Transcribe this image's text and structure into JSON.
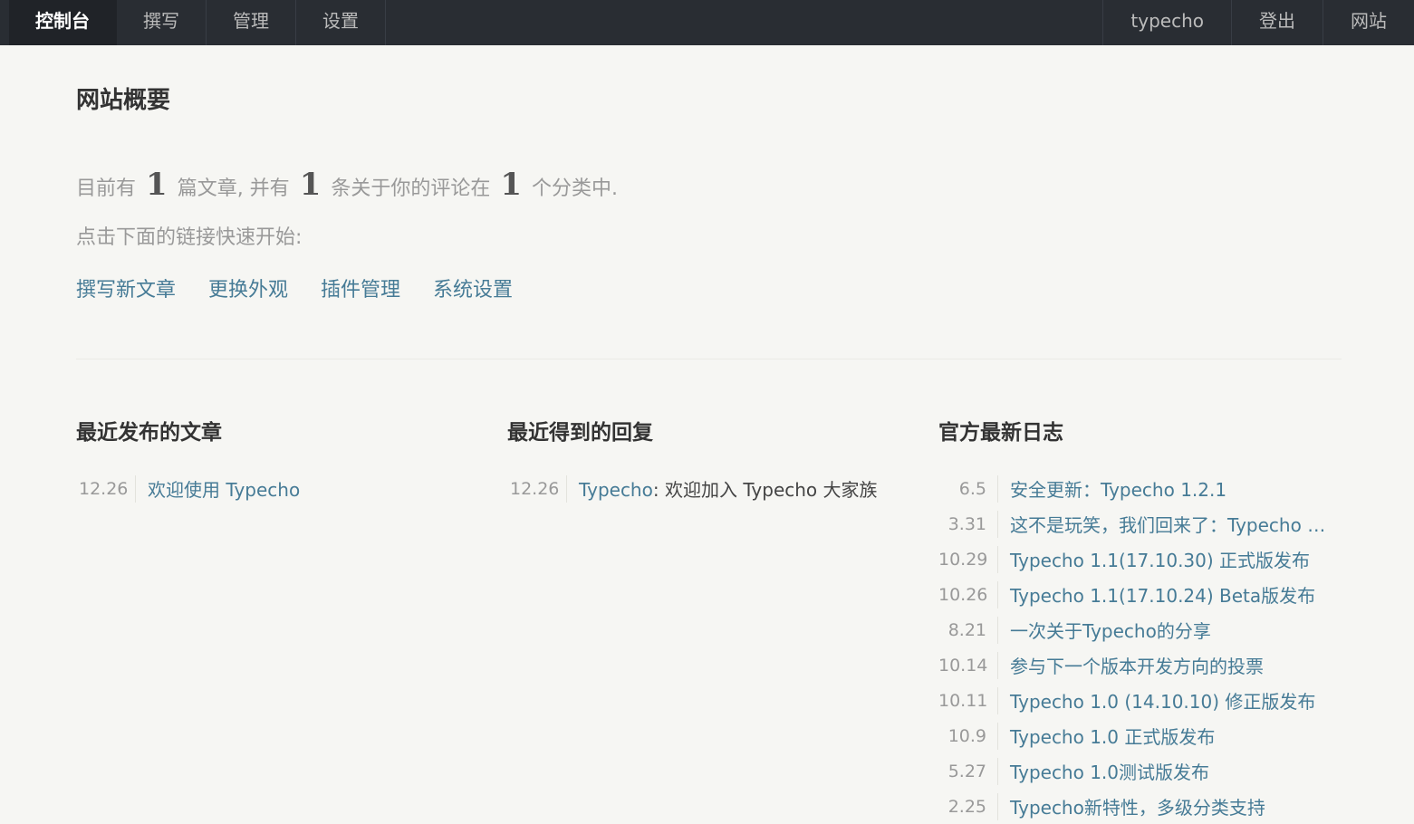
{
  "nav": {
    "left": [
      "控制台",
      "撰写",
      "管理",
      "设置"
    ],
    "right": [
      "typecho",
      "登出",
      "网站"
    ]
  },
  "page": {
    "title": "网站概要",
    "summary": {
      "p1": "目前有",
      "posts": "1",
      "p2": "篇文章, 并有",
      "comments": "1",
      "p3": "条关于你的评论在",
      "categories": "1",
      "p4": "个分类中."
    },
    "quick_tip": "点击下面的链接快速开始:",
    "quick_links": [
      "撰写新文章",
      "更换外观",
      "插件管理",
      "系统设置"
    ]
  },
  "recent_posts": {
    "title": "最近发布的文章",
    "items": [
      {
        "date": "12.26",
        "title": "欢迎使用 Typecho"
      }
    ]
  },
  "recent_comments": {
    "title": "最近得到的回复",
    "items": [
      {
        "date": "12.26",
        "author": "Typecho",
        "sep": ":",
        "text": "欢迎加入 Typecho 大家族"
      }
    ]
  },
  "official_log": {
    "title": "官方最新日志",
    "items": [
      {
        "date": "6.5",
        "title": "安全更新：Typecho 1.2.1"
      },
      {
        "date": "3.31",
        "title": "这不是玩笑，我们回来了：Typecho …"
      },
      {
        "date": "10.29",
        "title": "Typecho 1.1(17.10.30) 正式版发布"
      },
      {
        "date": "10.26",
        "title": "Typecho 1.1(17.10.24) Beta版发布"
      },
      {
        "date": "8.21",
        "title": "一次关于Typecho的分享"
      },
      {
        "date": "10.14",
        "title": "参与下一个版本开发方向的投票"
      },
      {
        "date": "10.11",
        "title": "Typecho 1.0 (14.10.10) 修正版发布"
      },
      {
        "date": "10.9",
        "title": "Typecho 1.0 正式版发布"
      },
      {
        "date": "5.27",
        "title": "Typecho 1.0测试版发布"
      },
      {
        "date": "2.25",
        "title": "Typecho新特性，多级分类支持"
      }
    ]
  }
}
